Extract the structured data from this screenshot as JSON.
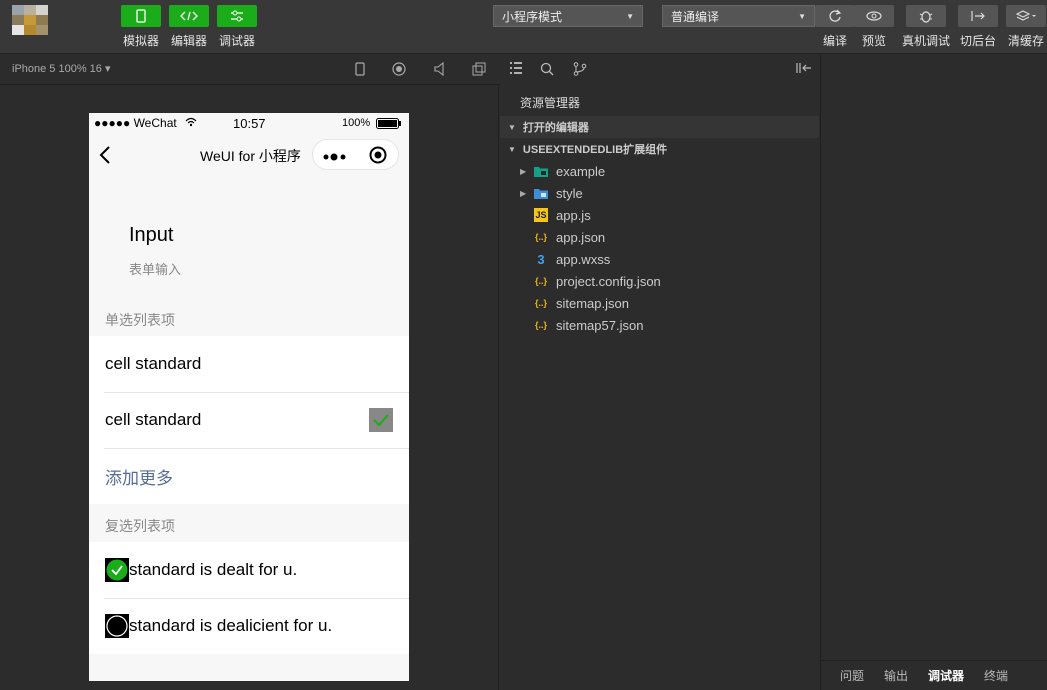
{
  "toolbar": {
    "simulator_label": "模拟器",
    "editor_label": "编辑器",
    "debugger_label": "调试器",
    "mode_select": "小程序模式",
    "compile_select": "普通编译",
    "compile_label": "编译",
    "preview_label": "预览",
    "remote_debug_label": "真机调试",
    "background_label": "切后台",
    "clear_cache_label": "清缓存"
  },
  "simulator": {
    "device": "iPhone 5 100% 16 ▾"
  },
  "phone": {
    "status_left": "●●●●● WeChat",
    "status_time": "10:57",
    "status_battery": "100%",
    "nav_title": "WeUI for 小程序",
    "page_title": "Input",
    "page_desc": "表单输入",
    "radio_group_title": "单选列表项",
    "radio_items": [
      "cell standard",
      "cell standard"
    ],
    "add_more": "添加更多",
    "checkbox_group_title": "复选列表项",
    "checkbox_items": [
      "standard is dealt for u.",
      "standard is dealicient for u."
    ]
  },
  "explorer": {
    "title": "资源管理器",
    "open_editors": "打开的编辑器",
    "project": "USEEXTENDEDLIB扩展组件",
    "files": [
      {
        "name": "example",
        "icon": "folder-icon"
      },
      {
        "name": "style",
        "icon": "folder-icon"
      },
      {
        "name": "app.js",
        "icon": "js-icon"
      },
      {
        "name": "app.json",
        "icon": "json-icon"
      },
      {
        "name": "app.wxss",
        "icon": "css-icon"
      },
      {
        "name": "project.config.json",
        "icon": "json-icon"
      },
      {
        "name": "sitemap.json",
        "icon": "json-icon"
      },
      {
        "name": "sitemap57.json",
        "icon": "json-icon"
      }
    ]
  },
  "debug_tabs": {
    "problems": "问题",
    "output": "输出",
    "debugger": "调试器",
    "terminal": "终端"
  }
}
